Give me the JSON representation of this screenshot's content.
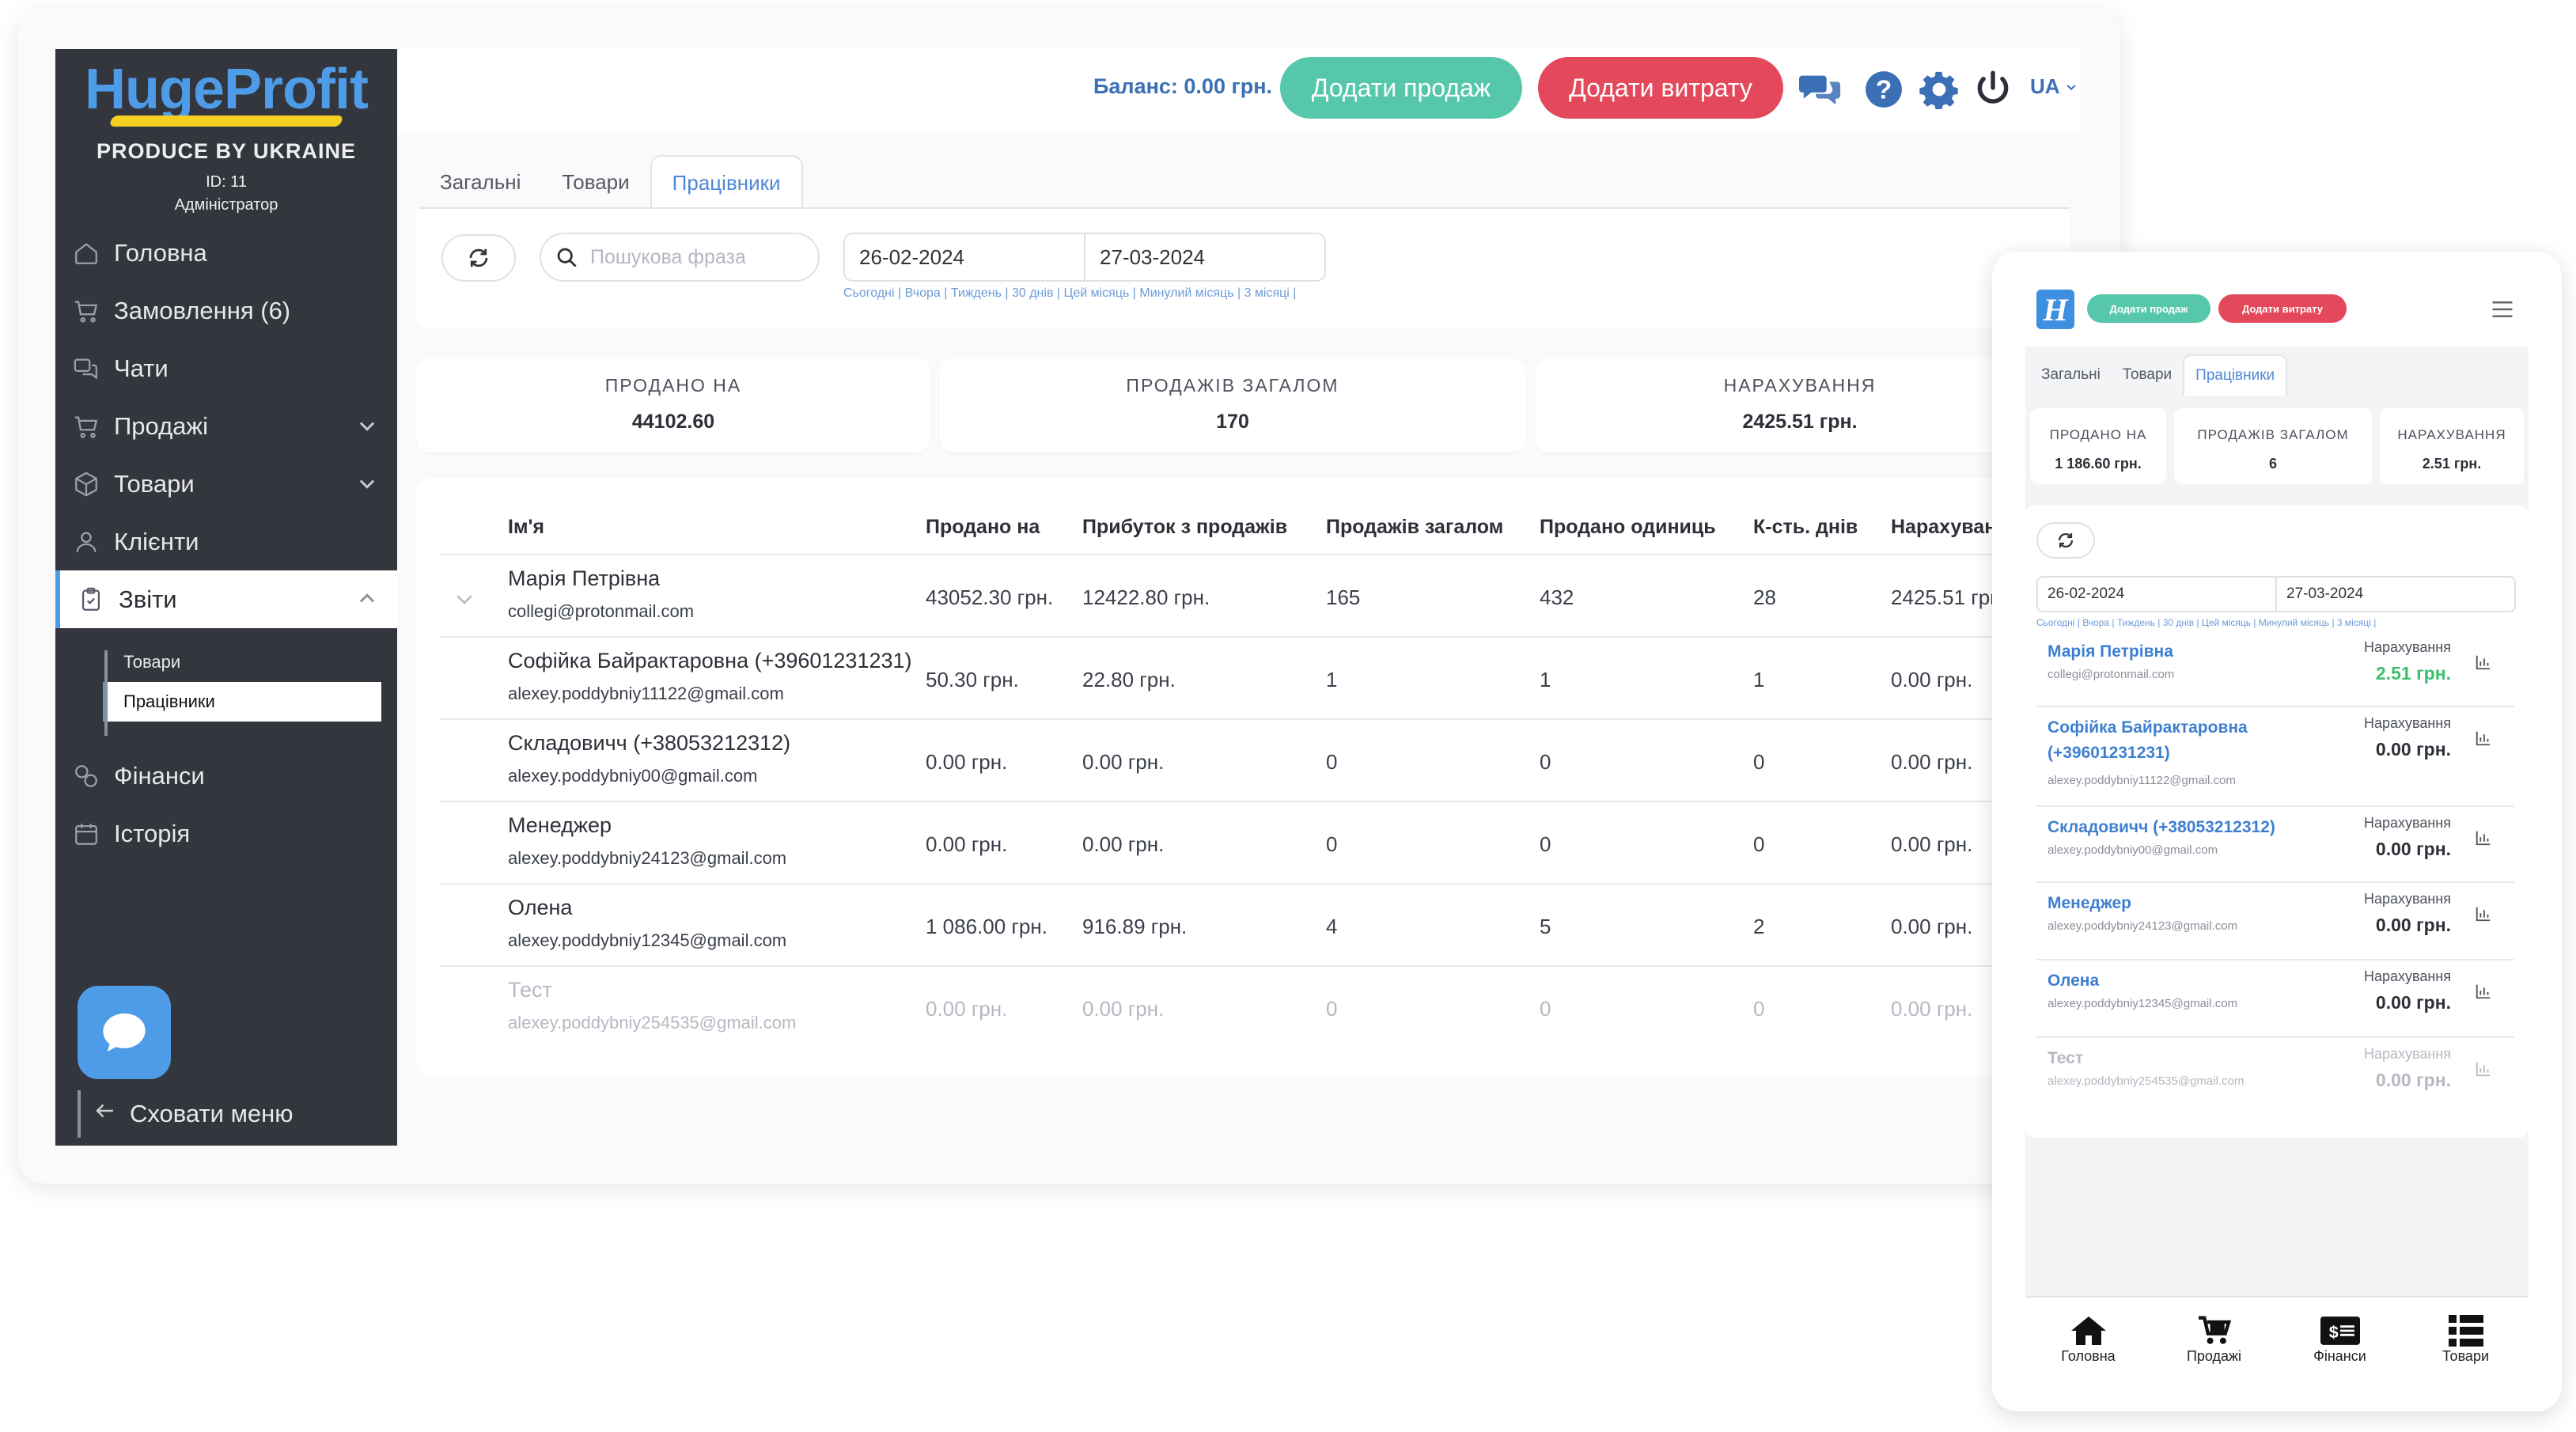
{
  "sidebar": {
    "logo_text": "HugeProfit",
    "tagline": "PRODUCE BY UKRAINE",
    "user_id": "ID: 11",
    "role": "Адміністратор",
    "items": [
      {
        "label": "Головна",
        "icon": "home-icon"
      },
      {
        "label": "Замовлення (6)",
        "icon": "cart-icon"
      },
      {
        "label": "Чати",
        "icon": "chat-icon"
      },
      {
        "label": "Продажі",
        "icon": "cart-icon"
      },
      {
        "label": "Товари",
        "icon": "box-icon"
      },
      {
        "label": "Клієнти",
        "icon": "users-icon"
      },
      {
        "label": "Звіти",
        "icon": "clipboard-icon"
      },
      {
        "label": "Фінанси",
        "icon": "coins-icon"
      },
      {
        "label": "Історія",
        "icon": "calendar-icon"
      }
    ],
    "sub_items": [
      "Товари",
      "Працівники"
    ],
    "hide_menu": "Сховати меню"
  },
  "topbar": {
    "balance": "Баланс: 0.00 грн.",
    "add_sale": "Додати продаж",
    "add_expense": "Додати витрату",
    "language": "UA"
  },
  "tabs": [
    "Загальні",
    "Товари",
    "Працівники"
  ],
  "filters": {
    "search_placeholder": "Пошукова фраза",
    "date_from": "26-02-2024",
    "date_to": "27-03-2024",
    "shortcuts": "Сьогодні | Вчора | Тиждень | 30 днів | Цей місяць | Минулий місяць | 3 місяці |"
  },
  "stats": [
    {
      "label": "ПРОДАНО НА",
      "value": "44102.60"
    },
    {
      "label": "ПРОДАЖІВ ЗАГАЛОМ",
      "value": "170"
    },
    {
      "label": "НАРАХУВАННЯ",
      "value": "2425.51 грн."
    }
  ],
  "table": {
    "headers": [
      "Ім'я",
      "Продано на",
      "Прибуток з продажів",
      "Продажів загалом",
      "Продано одиниць",
      "К-сть. днів",
      "Нарахуван"
    ],
    "rows": [
      {
        "name": "Марія Петрівна",
        "email": "collegi@protonmail.com",
        "sold": "43052.30 грн.",
        "profit": "12422.80 грн.",
        "sales": "165",
        "units": "432",
        "days": "28",
        "accrual": "2425.51 грн"
      },
      {
        "name": "Софійка Байрактаровна (+39601231231)",
        "email": "alexey.poddybniy11122@gmail.com",
        "sold": "50.30 грн.",
        "profit": "22.80 грн.",
        "sales": "1",
        "units": "1",
        "days": "1",
        "accrual": "0.00 грн."
      },
      {
        "name": "Складовичч (+38053212312)",
        "email": "alexey.poddybniy00@gmail.com",
        "sold": "0.00 грн.",
        "profit": "0.00 грн.",
        "sales": "0",
        "units": "0",
        "days": "0",
        "accrual": "0.00 грн."
      },
      {
        "name": "Менеджер",
        "email": "alexey.poddybniy24123@gmail.com",
        "sold": "0.00 грн.",
        "profit": "0.00 грн.",
        "sales": "0",
        "units": "0",
        "days": "0",
        "accrual": "0.00 грн."
      },
      {
        "name": "Олена",
        "email": "alexey.poddybniy12345@gmail.com",
        "sold": "1 086.00 грн.",
        "profit": "916.89 грн.",
        "sales": "4",
        "units": "5",
        "days": "2",
        "accrual": "0.00 грн."
      },
      {
        "name": "Тест",
        "email": "alexey.poddybniy254535@gmail.com",
        "sold": "0.00 грн.",
        "profit": "0.00 грн.",
        "sales": "0",
        "units": "0",
        "days": "0",
        "accrual": "0.00 грн."
      }
    ]
  },
  "mobile": {
    "logo_letter": "H",
    "add_sale": "Додати продаж",
    "add_expense": "Додати витрату",
    "tabs": [
      "Загальні",
      "Товари",
      "Працівники"
    ],
    "stats": [
      {
        "label": "ПРОДАНО НА",
        "value": "1 186.60 грн."
      },
      {
        "label": "ПРОДАЖІВ ЗАГАЛОМ",
        "value": "6"
      },
      {
        "label": "НАРАХУВАННЯ",
        "value": "2.51 грн."
      }
    ],
    "date_from": "26-02-2024",
    "date_to": "27-03-2024",
    "shortcuts": "Сьогодні | Вчора | Тиждень | 30 днів | Цей місяць | Минулий місяць | 3 місяці |",
    "accrual_label": "Нарахування",
    "rows": [
      {
        "name": "Марія Петрівна",
        "email": "collegi@protonmail.com",
        "accrual": "2.51 грн."
      },
      {
        "name": "Софійка Байрактаровна (+39601231231)",
        "email": "alexey.poddybniy11122@gmail.com",
        "accrual": "0.00 грн."
      },
      {
        "name": "Складовичч (+38053212312)",
        "email": "alexey.poddybniy00@gmail.com",
        "accrual": "0.00 грн."
      },
      {
        "name": "Менеджер",
        "email": "alexey.poddybniy24123@gmail.com",
        "accrual": "0.00 грн."
      },
      {
        "name": "Олена",
        "email": "alexey.poddybniy12345@gmail.com",
        "accrual": "0.00 грн."
      },
      {
        "name": "Тест",
        "email": "alexey.poddybniy254535@gmail.com",
        "accrual": "0.00 грн."
      }
    ],
    "bottom_nav": [
      {
        "label": "Головна",
        "icon": "home-icon"
      },
      {
        "label": "Продажі",
        "icon": "cart-icon"
      },
      {
        "label": "Фінанси",
        "icon": "money-icon"
      },
      {
        "label": "Товари",
        "icon": "list-icon"
      }
    ]
  },
  "colors": {
    "accent": "#4e9be7",
    "sale_button": "#57c7ac",
    "expense_button": "#e3495a",
    "sidebar_bg": "#34363d",
    "link": "#3e7fd1",
    "positive": "#3cbf6e"
  }
}
